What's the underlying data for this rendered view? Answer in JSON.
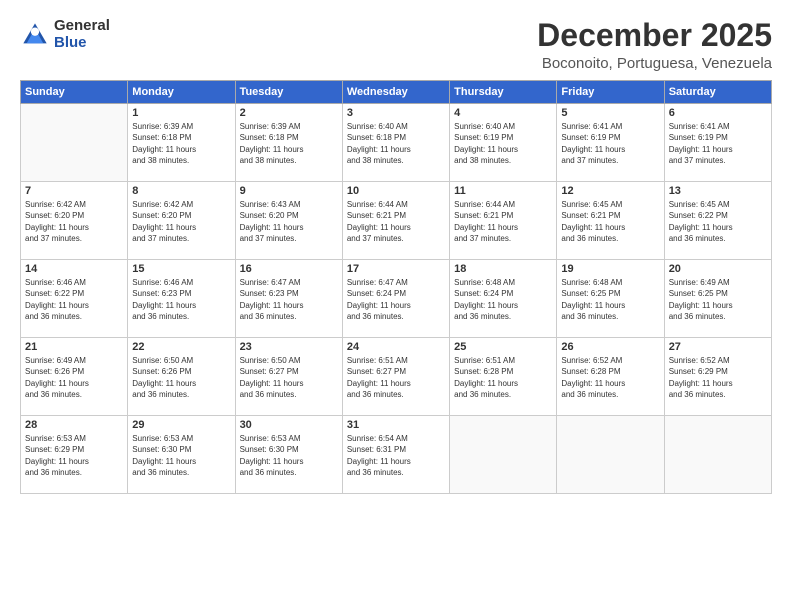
{
  "logo": {
    "general": "General",
    "blue": "Blue"
  },
  "title": "December 2025",
  "subtitle": "Boconoito, Portuguesa, Venezuela",
  "days": [
    "Sunday",
    "Monday",
    "Tuesday",
    "Wednesday",
    "Thursday",
    "Friday",
    "Saturday"
  ],
  "weeks": [
    [
      {
        "day": "",
        "info": ""
      },
      {
        "day": "1",
        "info": "Sunrise: 6:39 AM\nSunset: 6:18 PM\nDaylight: 11 hours\nand 38 minutes."
      },
      {
        "day": "2",
        "info": "Sunrise: 6:39 AM\nSunset: 6:18 PM\nDaylight: 11 hours\nand 38 minutes."
      },
      {
        "day": "3",
        "info": "Sunrise: 6:40 AM\nSunset: 6:18 PM\nDaylight: 11 hours\nand 38 minutes."
      },
      {
        "day": "4",
        "info": "Sunrise: 6:40 AM\nSunset: 6:19 PM\nDaylight: 11 hours\nand 38 minutes."
      },
      {
        "day": "5",
        "info": "Sunrise: 6:41 AM\nSunset: 6:19 PM\nDaylight: 11 hours\nand 37 minutes."
      },
      {
        "day": "6",
        "info": "Sunrise: 6:41 AM\nSunset: 6:19 PM\nDaylight: 11 hours\nand 37 minutes."
      }
    ],
    [
      {
        "day": "7",
        "info": "Sunrise: 6:42 AM\nSunset: 6:20 PM\nDaylight: 11 hours\nand 37 minutes."
      },
      {
        "day": "8",
        "info": "Sunrise: 6:42 AM\nSunset: 6:20 PM\nDaylight: 11 hours\nand 37 minutes."
      },
      {
        "day": "9",
        "info": "Sunrise: 6:43 AM\nSunset: 6:20 PM\nDaylight: 11 hours\nand 37 minutes."
      },
      {
        "day": "10",
        "info": "Sunrise: 6:44 AM\nSunset: 6:21 PM\nDaylight: 11 hours\nand 37 minutes."
      },
      {
        "day": "11",
        "info": "Sunrise: 6:44 AM\nSunset: 6:21 PM\nDaylight: 11 hours\nand 37 minutes."
      },
      {
        "day": "12",
        "info": "Sunrise: 6:45 AM\nSunset: 6:21 PM\nDaylight: 11 hours\nand 36 minutes."
      },
      {
        "day": "13",
        "info": "Sunrise: 6:45 AM\nSunset: 6:22 PM\nDaylight: 11 hours\nand 36 minutes."
      }
    ],
    [
      {
        "day": "14",
        "info": "Sunrise: 6:46 AM\nSunset: 6:22 PM\nDaylight: 11 hours\nand 36 minutes."
      },
      {
        "day": "15",
        "info": "Sunrise: 6:46 AM\nSunset: 6:23 PM\nDaylight: 11 hours\nand 36 minutes."
      },
      {
        "day": "16",
        "info": "Sunrise: 6:47 AM\nSunset: 6:23 PM\nDaylight: 11 hours\nand 36 minutes."
      },
      {
        "day": "17",
        "info": "Sunrise: 6:47 AM\nSunset: 6:24 PM\nDaylight: 11 hours\nand 36 minutes."
      },
      {
        "day": "18",
        "info": "Sunrise: 6:48 AM\nSunset: 6:24 PM\nDaylight: 11 hours\nand 36 minutes."
      },
      {
        "day": "19",
        "info": "Sunrise: 6:48 AM\nSunset: 6:25 PM\nDaylight: 11 hours\nand 36 minutes."
      },
      {
        "day": "20",
        "info": "Sunrise: 6:49 AM\nSunset: 6:25 PM\nDaylight: 11 hours\nand 36 minutes."
      }
    ],
    [
      {
        "day": "21",
        "info": "Sunrise: 6:49 AM\nSunset: 6:26 PM\nDaylight: 11 hours\nand 36 minutes."
      },
      {
        "day": "22",
        "info": "Sunrise: 6:50 AM\nSunset: 6:26 PM\nDaylight: 11 hours\nand 36 minutes."
      },
      {
        "day": "23",
        "info": "Sunrise: 6:50 AM\nSunset: 6:27 PM\nDaylight: 11 hours\nand 36 minutes."
      },
      {
        "day": "24",
        "info": "Sunrise: 6:51 AM\nSunset: 6:27 PM\nDaylight: 11 hours\nand 36 minutes."
      },
      {
        "day": "25",
        "info": "Sunrise: 6:51 AM\nSunset: 6:28 PM\nDaylight: 11 hours\nand 36 minutes."
      },
      {
        "day": "26",
        "info": "Sunrise: 6:52 AM\nSunset: 6:28 PM\nDaylight: 11 hours\nand 36 minutes."
      },
      {
        "day": "27",
        "info": "Sunrise: 6:52 AM\nSunset: 6:29 PM\nDaylight: 11 hours\nand 36 minutes."
      }
    ],
    [
      {
        "day": "28",
        "info": "Sunrise: 6:53 AM\nSunset: 6:29 PM\nDaylight: 11 hours\nand 36 minutes."
      },
      {
        "day": "29",
        "info": "Sunrise: 6:53 AM\nSunset: 6:30 PM\nDaylight: 11 hours\nand 36 minutes."
      },
      {
        "day": "30",
        "info": "Sunrise: 6:53 AM\nSunset: 6:30 PM\nDaylight: 11 hours\nand 36 minutes."
      },
      {
        "day": "31",
        "info": "Sunrise: 6:54 AM\nSunset: 6:31 PM\nDaylight: 11 hours\nand 36 minutes."
      },
      {
        "day": "",
        "info": ""
      },
      {
        "day": "",
        "info": ""
      },
      {
        "day": "",
        "info": ""
      }
    ]
  ]
}
